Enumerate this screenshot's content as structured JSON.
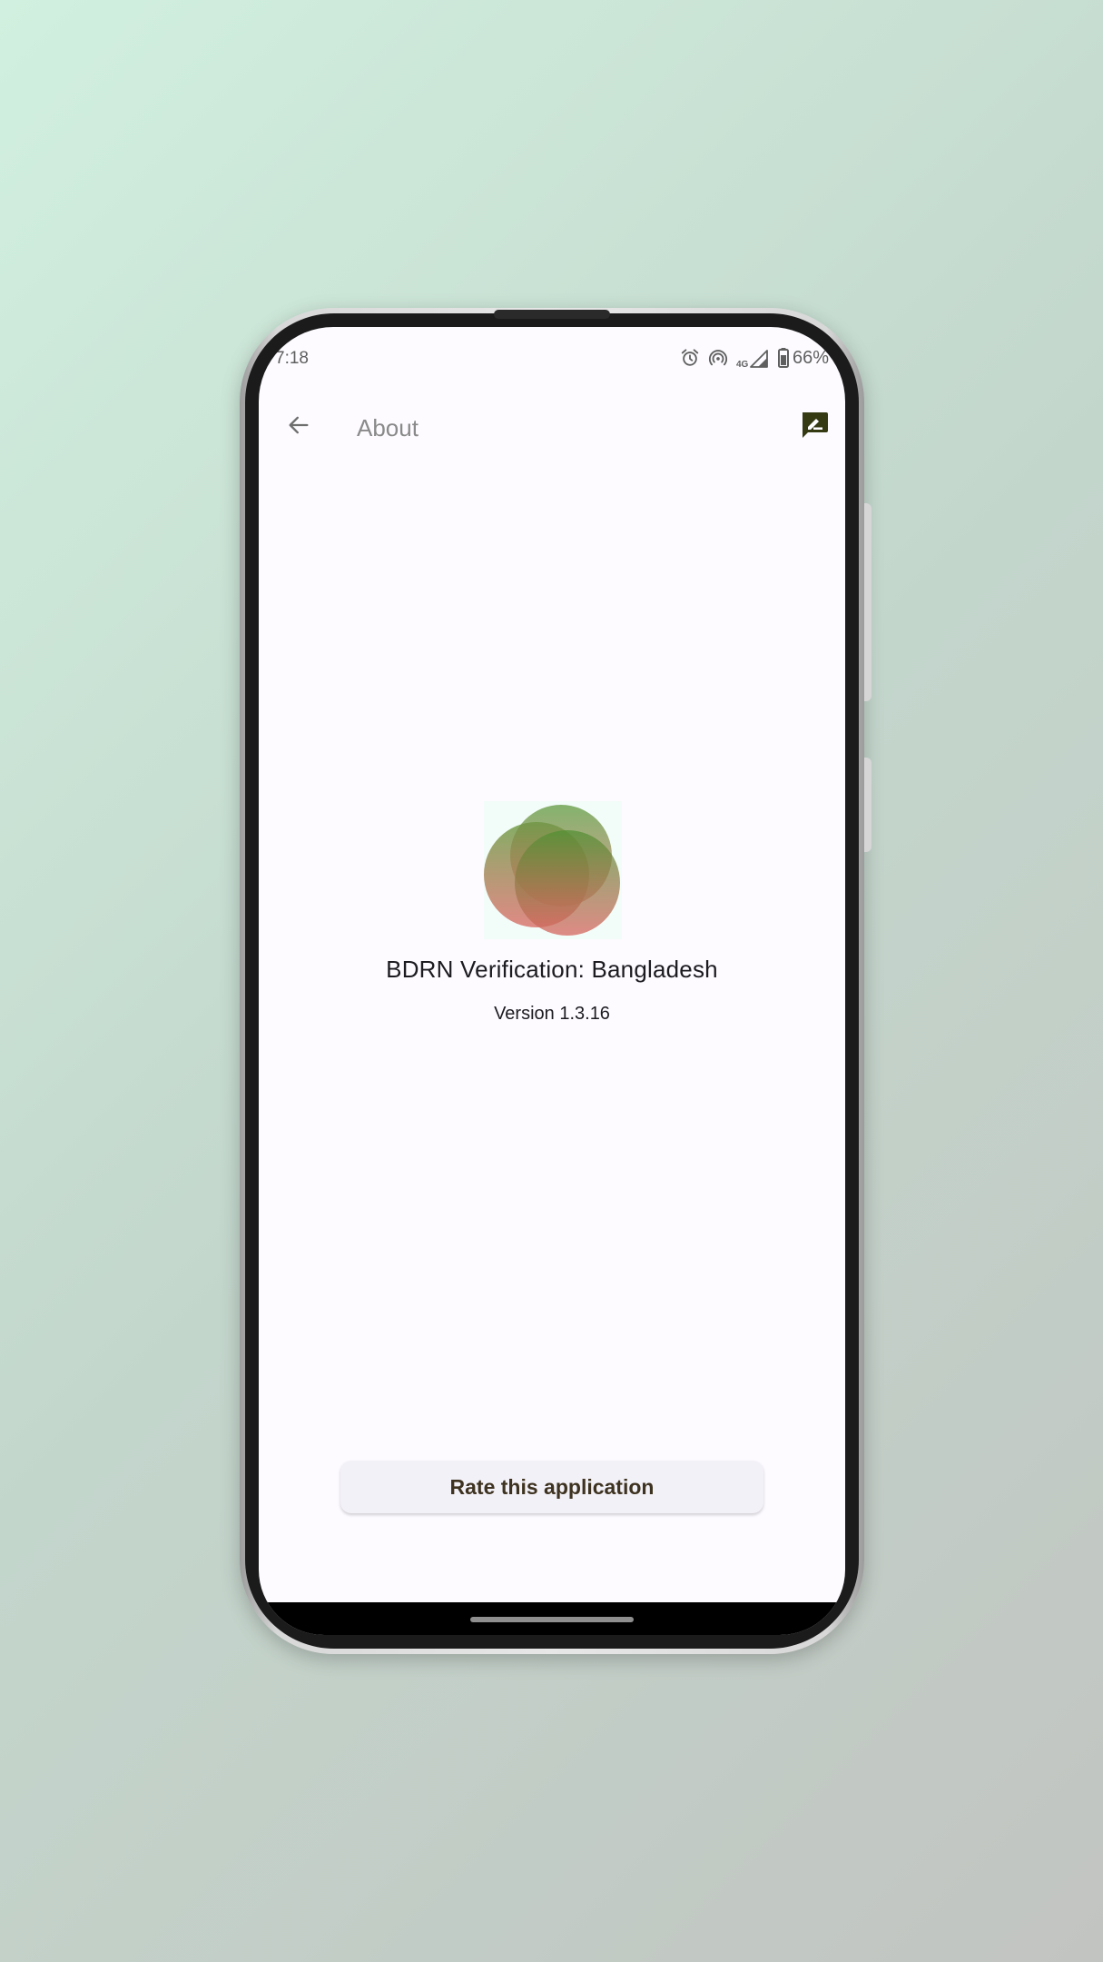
{
  "status_bar": {
    "time": "7:18",
    "icons": [
      "alarm-icon",
      "hotspot-icon",
      "network-4g-icon",
      "signal-icon",
      "battery-icon"
    ],
    "network_label": "4G",
    "battery": "66%"
  },
  "app_bar": {
    "title": "About",
    "back_icon": "arrow-back-icon",
    "action_icon": "feedback-icon"
  },
  "about": {
    "app_name": "BDRN Verification: Bangladesh",
    "version": "Version 1.3.16"
  },
  "actions": {
    "rate_label": "Rate this application"
  },
  "colors": {
    "background": "#fdfbff",
    "button_background": "#f3f1f8",
    "button_text": "#3e3320",
    "feedback_icon": "#353a13",
    "logo_green": "#5e9a3e",
    "logo_red": "#d8645e"
  }
}
